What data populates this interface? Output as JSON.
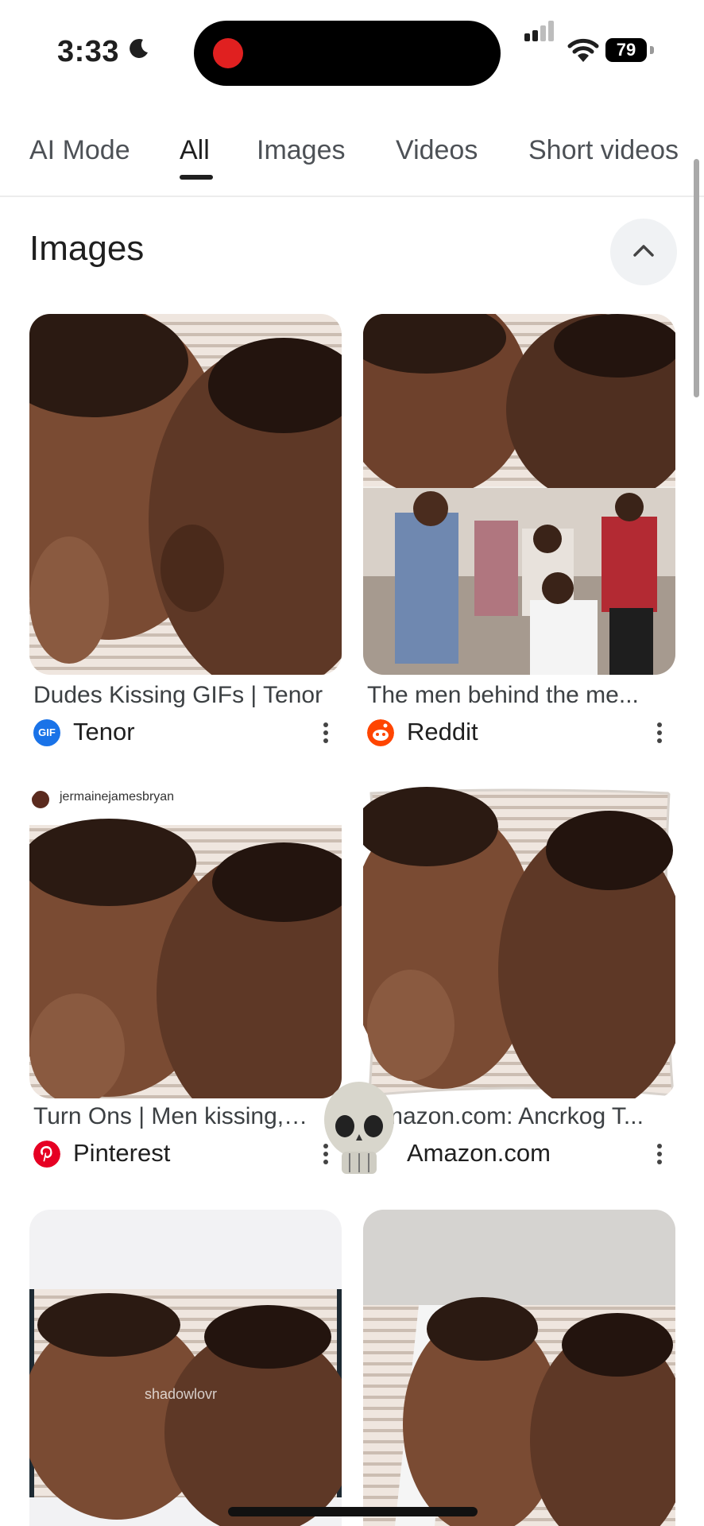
{
  "status": {
    "time": "3:33",
    "battery": "79"
  },
  "tabs": [
    "AI Mode",
    "All",
    "Images",
    "Videos",
    "Short videos"
  ],
  "section": {
    "title": "Images"
  },
  "results": [
    {
      "caption": "Dudes Kissing GIFs | Tenor",
      "source": "Tenor",
      "icon_label": "GIF"
    },
    {
      "caption": "The men behind the me...",
      "source": "Reddit"
    },
    {
      "caption": "Turn Ons | Men kissing, B...",
      "source": "Pinterest",
      "overlay_text": "jermainejamesbryan"
    },
    {
      "caption": "Amazon.com: Ancrkog T...",
      "source": "Amazon.com"
    },
    {
      "overlay_text": "shadowlovr"
    }
  ],
  "colors": {
    "reddit": "#ff4500",
    "pinterest": "#e60023",
    "tenor": "#1a73e8",
    "active_tab": "#1f1f1f"
  }
}
